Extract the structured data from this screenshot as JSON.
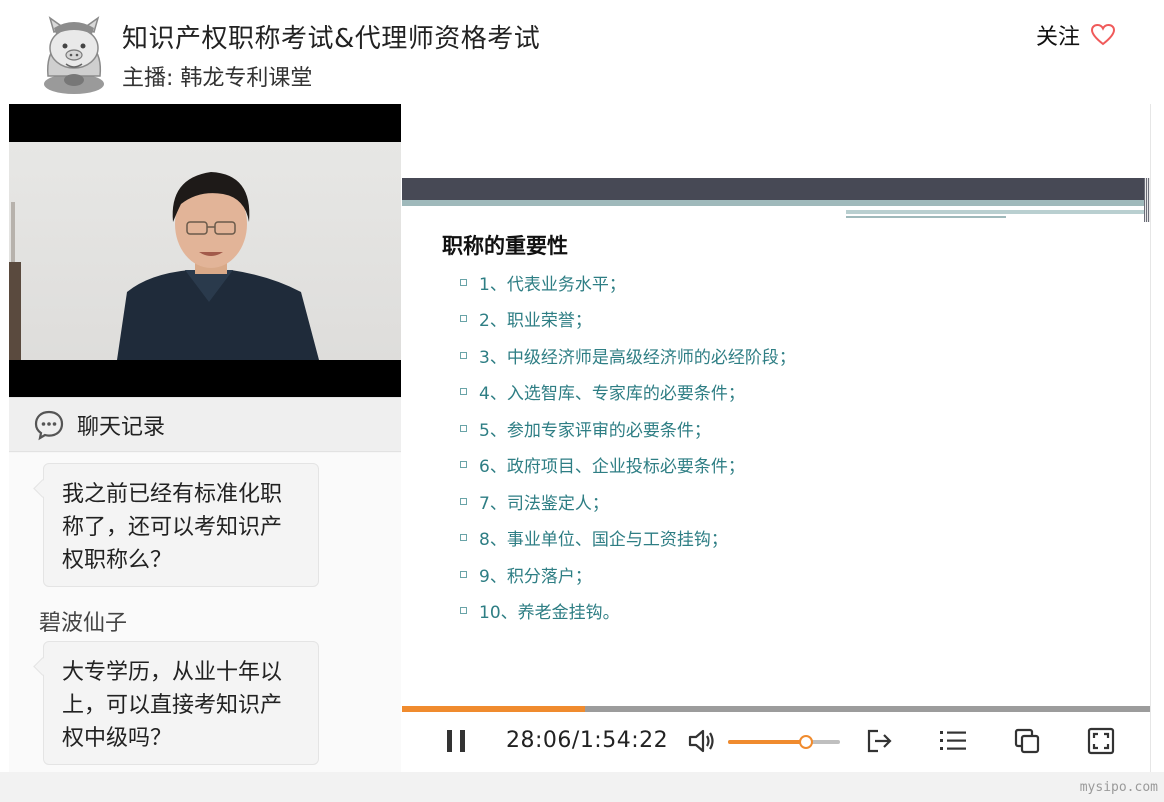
{
  "header": {
    "title": "知识产权职称考试&代理师资格考试",
    "host": "主播: 韩龙专利课堂",
    "follow_label": "关注"
  },
  "chat": {
    "title": "聊天记录",
    "messages": [
      {
        "user": "",
        "text": "我之前已经有标准化职称了，还可以考知识产权职称么？"
      },
      {
        "user": "碧波仙子",
        "text": "大专学历，从业十年以上，可以直接考知识产权中级吗？"
      }
    ]
  },
  "slide": {
    "heading": "职称的重要性",
    "items": [
      "1、代表业务水平；",
      "2、职业荣誉；",
      "3、中级经济师是高级经济师的必经阶段；",
      "4、入选智库、专家库的必要条件；",
      "5、参加专家评审的必要条件；",
      "6、政府项目、企业投标必要条件；",
      "7、司法鉴定人；",
      "8、事业单位、国企与工资挂钩；",
      "9、积分落户；",
      "10、养老金挂钩。"
    ]
  },
  "player": {
    "time": "28:06/1:54:22",
    "progress": 0.245,
    "volume": 0.7,
    "accent": "#f08b2e"
  },
  "icons": [
    "avatar-pig-icon",
    "heart-icon",
    "chat-bubble-icon",
    "pause-icon",
    "volume-icon",
    "exit-icon",
    "playlist-icon",
    "copy-icon",
    "fullscreen-icon"
  ],
  "watermark": "mysipo.com"
}
